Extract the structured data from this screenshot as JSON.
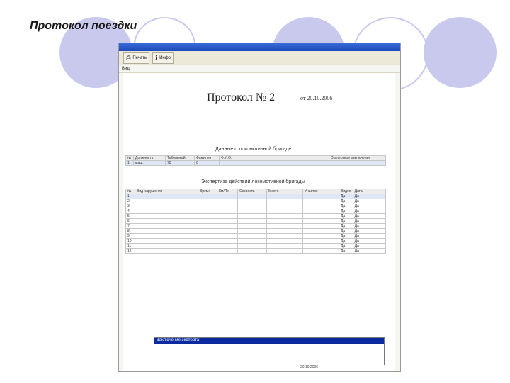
{
  "slide": {
    "title": "Протокол поездки"
  },
  "window": {
    "toolbar": {
      "btn1_label": "Печать",
      "btn2_label": "Инфо"
    },
    "menu": {
      "label": "Вид"
    }
  },
  "document": {
    "title": "Протокол № 2",
    "date": "от 20.10.2006",
    "crew_section_title": "Данные о локомотивной бригаде",
    "crew_table": {
      "headers": [
        "№",
        "Должность",
        "Табельный",
        "Фамилия",
        "Ф.И.О.",
        "Экспертное заключение"
      ],
      "rows": [
        [
          "1",
          "маш.",
          "70",
          "0",
          "",
          ""
        ]
      ]
    },
    "exam_section_title": "Экспертиза действий локомотивной бригады",
    "exam_table": {
      "headers": [
        "№",
        "Вид нарушения",
        "Время",
        "Км/Пк",
        "Скорость",
        "Место",
        "Участок",
        "Видео",
        "Дата"
      ],
      "rows": [
        [
          "1",
          "",
          "",
          "",
          "",
          "",
          "",
          "Да",
          "Да"
        ],
        [
          "2",
          "",
          "",
          "",
          "",
          "",
          "",
          "Да",
          "Да"
        ],
        [
          "3",
          "",
          "",
          "",
          "",
          "",
          "",
          "Да",
          "Да"
        ],
        [
          "4",
          "",
          "",
          "",
          "",
          "",
          "",
          "Да",
          "Да"
        ],
        [
          "5",
          "",
          "",
          "",
          "",
          "",
          "",
          "Да",
          "Да"
        ],
        [
          "6",
          "",
          "",
          "",
          "",
          "",
          "",
          "Да",
          "Да"
        ],
        [
          "7",
          "",
          "",
          "",
          "",
          "",
          "",
          "Да",
          "Да"
        ],
        [
          "8",
          "",
          "",
          "",
          "",
          "",
          "",
          "Да",
          "Да"
        ],
        [
          "9",
          "",
          "",
          "",
          "",
          "",
          "",
          "Да",
          "Да"
        ],
        [
          "10",
          "",
          "",
          "",
          "",
          "",
          "",
          "Да",
          "Да"
        ],
        [
          "11",
          "",
          "",
          "",
          "",
          "",
          "",
          "Да",
          "Да"
        ],
        [
          "12",
          "",
          "",
          "",
          "",
          "",
          "",
          "Да",
          "Да"
        ]
      ]
    },
    "conclusion_header": "Заключение эксперта",
    "bottom_date": "20.10.2006"
  }
}
